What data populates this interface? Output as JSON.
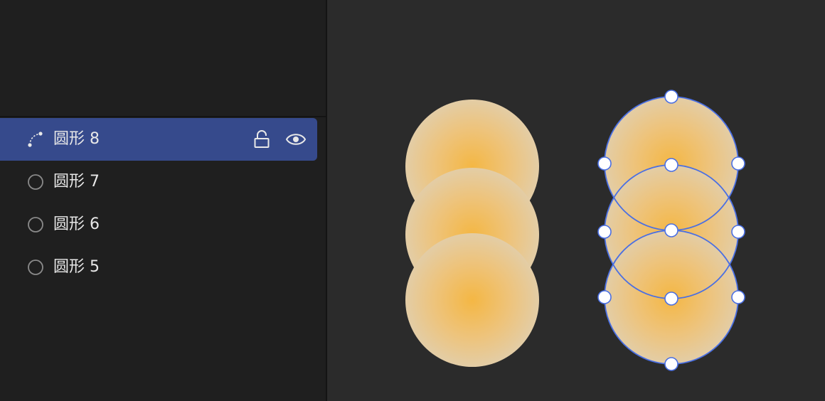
{
  "layers_panel": {
    "rows": [
      {
        "label": "圆形 8",
        "icon": "path-curve-icon",
        "selected": true
      },
      {
        "label": "圆形 7",
        "icon": "circle-outline-icon",
        "selected": false
      },
      {
        "label": "圆形 6",
        "icon": "circle-outline-icon",
        "selected": false
      },
      {
        "label": "圆形 5",
        "icon": "circle-outline-icon",
        "selected": false
      }
    ],
    "row_actions": {
      "lock": "lock-open-icon",
      "visibility": "eye-icon"
    }
  },
  "colors": {
    "panel_bg": "#1f1f1f",
    "canvas_bg": "#2b2b2b",
    "selection_bg": "#364a8c",
    "selection_outline": "#4a6fe3",
    "circle_center": "#f4b744",
    "circle_edge": "#e3cda6",
    "text": "#e8e8e8",
    "icon_muted": "#8a8a8a"
  }
}
